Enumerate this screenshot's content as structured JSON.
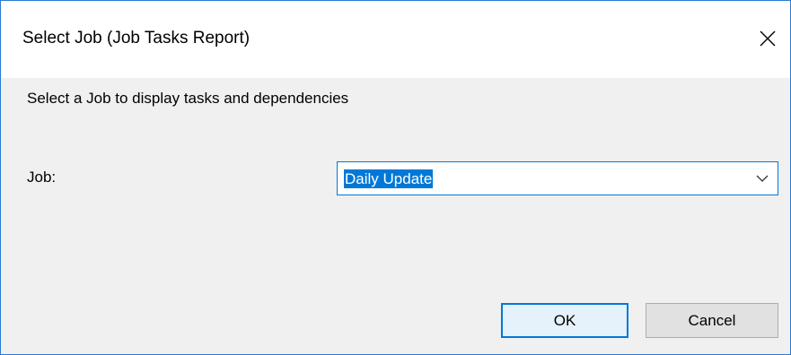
{
  "window": {
    "title": "Select Job (Job Tasks Report)",
    "close_icon": "close-icon"
  },
  "content": {
    "description": "Select a Job to display tasks and dependencies",
    "job_label": "Job:",
    "job_select": {
      "selected_value": "Daily Update",
      "arrow_icon": "chevron-down-icon"
    }
  },
  "buttons": {
    "ok_label": "OK",
    "cancel_label": "Cancel"
  },
  "colors": {
    "accent": "#0078d7",
    "window_border": "#2b7cd3",
    "dialog_background": "#f0f0f0",
    "button_face": "#e1e1e1"
  }
}
